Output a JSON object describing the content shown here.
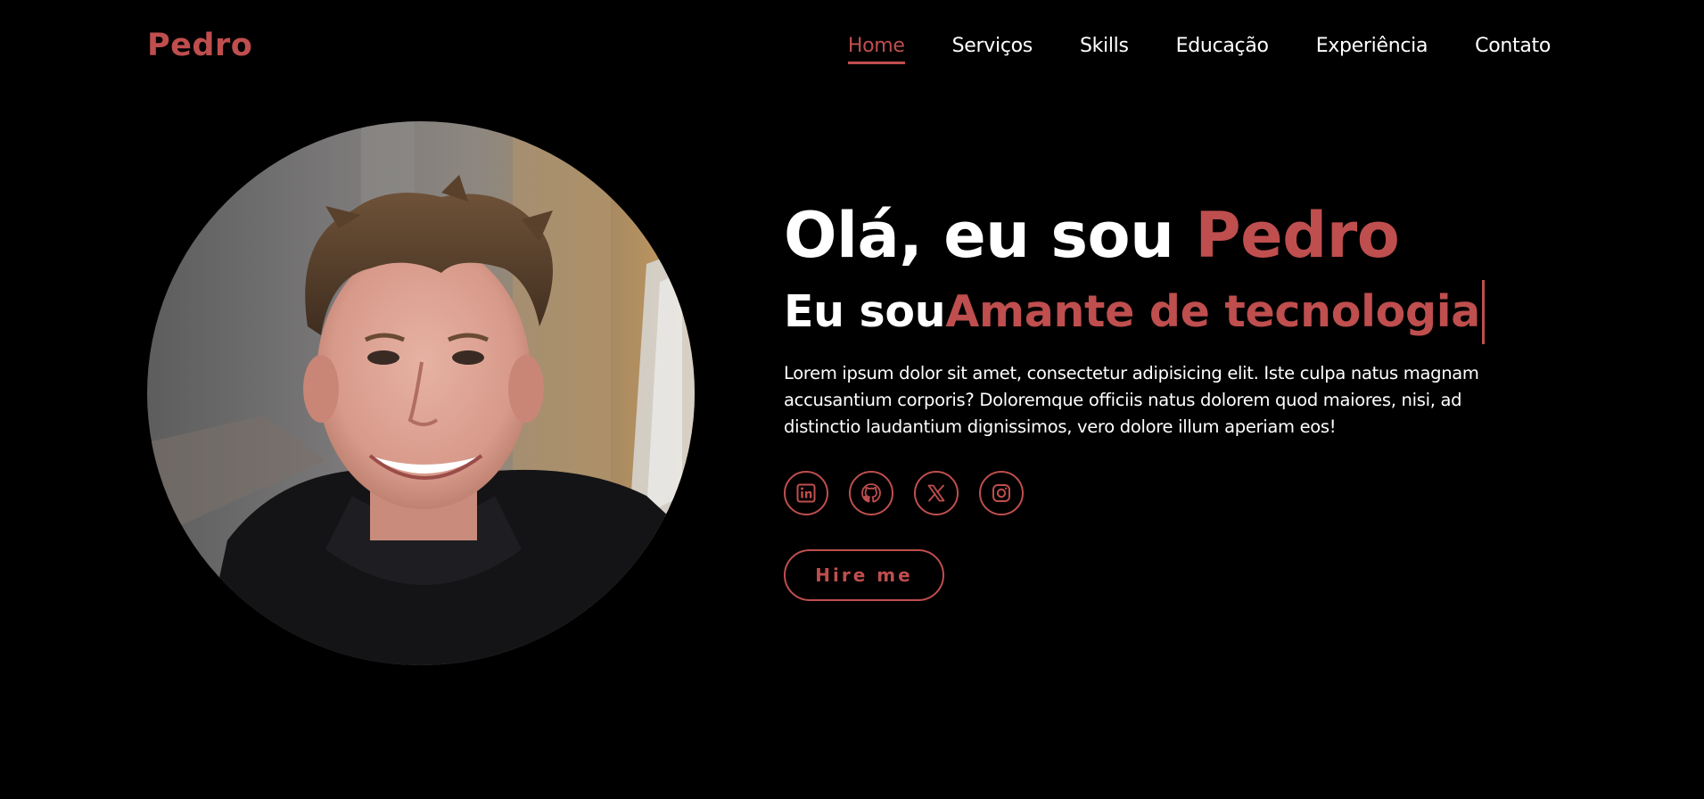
{
  "brand": {
    "name": "Pedro",
    "accent_color": "#bf4e4e",
    "background_color": "#000000"
  },
  "nav": {
    "items": [
      {
        "label": "Home",
        "active": true
      },
      {
        "label": "Serviços",
        "active": false
      },
      {
        "label": "Skills",
        "active": false
      },
      {
        "label": "Educação",
        "active": false
      },
      {
        "label": "Experiência",
        "active": false
      },
      {
        "label": "Contato",
        "active": false
      }
    ]
  },
  "hero": {
    "greeting": "Olá, eu sou ",
    "name": "Pedro",
    "role_prefix": "Eu sou",
    "role": "Amante de tecnologia",
    "description": "Lorem ipsum dolor sit amet, consectetur adipisicing elit. Iste culpa natus magnam accusantium corporis? Doloremque officiis natus dolorem quod maiores, nisi, ad distinctio laudantium dignissimos, vero dolore illum aperiam eos!",
    "cta_label": "Hire me"
  },
  "socials": [
    {
      "icon": "linkedin-icon"
    },
    {
      "icon": "github-icon"
    },
    {
      "icon": "x-icon"
    },
    {
      "icon": "instagram-icon"
    }
  ]
}
